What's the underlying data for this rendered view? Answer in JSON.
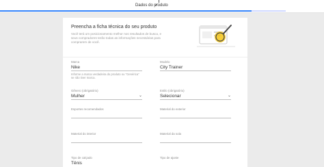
{
  "topbar": {
    "step_title": "Dados do produto",
    "progress": 0.88,
    "check": "✓"
  },
  "header": {
    "title": "Preencha a ficha técnica do seu produto",
    "subtitle": "Você terá um posicionamento melhor nos resultados de busca, e seus compradores terão todas as informações necessárias para comprarem de você."
  },
  "fields": {
    "marca": {
      "label": "Marca",
      "value": "Nike",
      "help": "Informe a marca verdadeira do produto ou \"Genérica\" se não tiver marca."
    },
    "modelo": {
      "label": "Modelo",
      "value": "City Trainer"
    },
    "genero": {
      "label": "Gênero (obrigatório)",
      "value": "Mulher"
    },
    "estilo": {
      "label": "Estilo (obrigatório)",
      "value": "Selecionar"
    },
    "esportes": {
      "label": "Esportes recomendados",
      "value": ""
    },
    "material_exterior": {
      "label": "Material do exterior",
      "value": ""
    },
    "material_interior": {
      "label": "Material do interior",
      "value": ""
    },
    "material_sola": {
      "label": "Material da sola",
      "value": ""
    },
    "tipo_calcado": {
      "label": "Tipo de calçado",
      "value": "Tênis"
    },
    "tipo_ajuste": {
      "label": "Tipo de ajuste",
      "value": ""
    }
  },
  "icons": {
    "dropdown": "chevron-down-icon",
    "illustration": "magnifier-illustration"
  },
  "colors": {
    "accent": "#3483fa",
    "illustration": "#f5c518"
  }
}
